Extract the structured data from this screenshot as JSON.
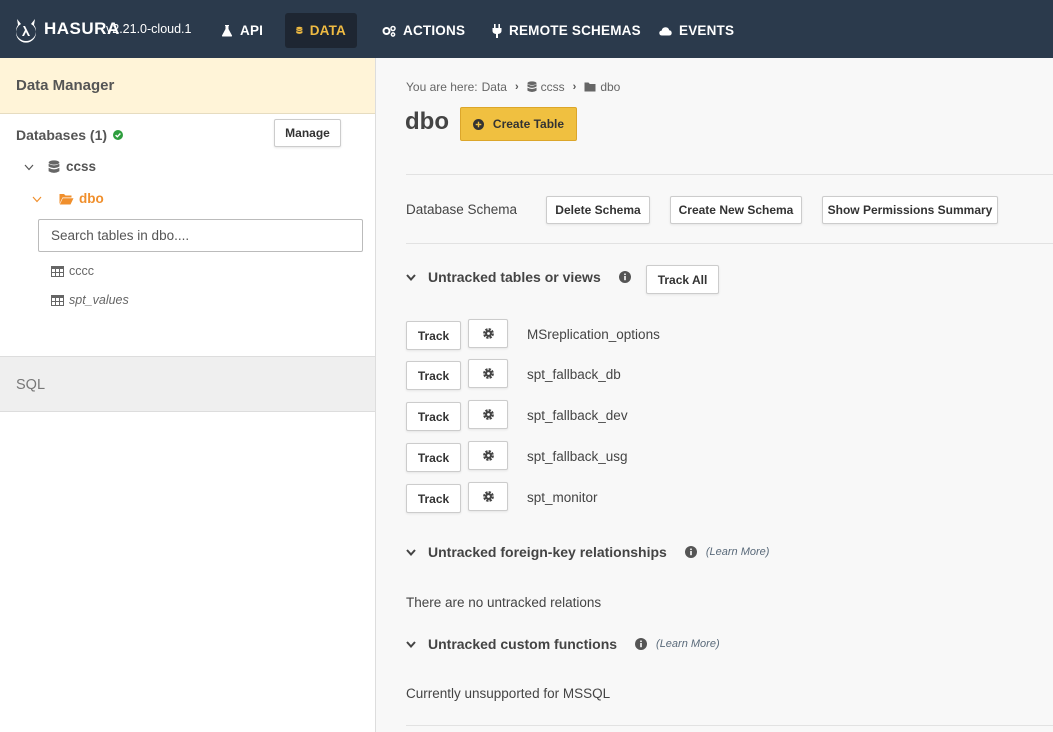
{
  "header": {
    "brand": "HASURA",
    "version": "v2.21.0-cloud.1",
    "nav": [
      {
        "label": "API",
        "icon": "flask-icon"
      },
      {
        "label": "DATA",
        "icon": "database-icon",
        "active": true
      },
      {
        "label": "ACTIONS",
        "icon": "gears-icon"
      },
      {
        "label": "REMOTE SCHEMAS",
        "icon": "plug-icon"
      },
      {
        "label": "EVENTS",
        "icon": "cloud-icon"
      }
    ]
  },
  "sidebar": {
    "title": "Data Manager",
    "databases_label": "Databases (1)",
    "manage_label": "Manage",
    "database": "ccss",
    "schema": "dbo",
    "search_placeholder": "Search tables in dbo....",
    "tables": [
      "cccc",
      "spt_values"
    ],
    "sql_label": "SQL"
  },
  "main": {
    "breadcrumb": {
      "prefix": "You are here:",
      "data": "Data",
      "database": "ccss",
      "schema": "dbo"
    },
    "title": "dbo",
    "create_table_label": "Create Table",
    "schema_row": {
      "label": "Database Schema",
      "delete_label": "Delete Schema",
      "create_label": "Create New Schema",
      "permissions_label": "Show Permissions Summary"
    },
    "untracked_tables": {
      "heading": "Untracked tables or views",
      "track_all_label": "Track All",
      "track_label": "Track",
      "rows": [
        "MSreplication_options",
        "spt_fallback_db",
        "spt_fallback_dev",
        "spt_fallback_usg",
        "spt_monitor"
      ]
    },
    "untracked_relations": {
      "heading": "Untracked foreign-key relationships",
      "learn_more": "(Learn More)",
      "message": "There are no untracked relations"
    },
    "untracked_functions": {
      "heading": "Untracked custom functions",
      "learn_more": "(Learn More)",
      "message": "Currently unsupported for MSSQL"
    }
  },
  "colors": {
    "topbar": "#2b3a4c",
    "accent": "#f0bb42",
    "schema_orange": "#f08f2c",
    "status_ok": "#2e9e3e"
  }
}
